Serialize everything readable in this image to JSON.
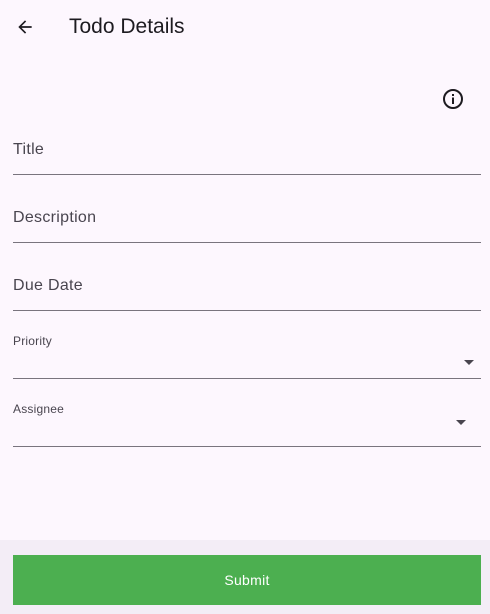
{
  "app_bar": {
    "title": "Todo Details",
    "back_icon": "arrow-back-icon"
  },
  "info": {
    "icon": "info-icon"
  },
  "form": {
    "title_label": "Title",
    "description_label": "Description",
    "due_date_label": "Due Date",
    "priority_label": "Priority",
    "assignee_label": "Assignee"
  },
  "footer": {
    "submit_label": "Submit"
  },
  "colors": {
    "background": "#fdf7fe",
    "submit_button": "#4caf50",
    "bottom_bar": "#f3edf6",
    "field_underline": "#79747e"
  }
}
